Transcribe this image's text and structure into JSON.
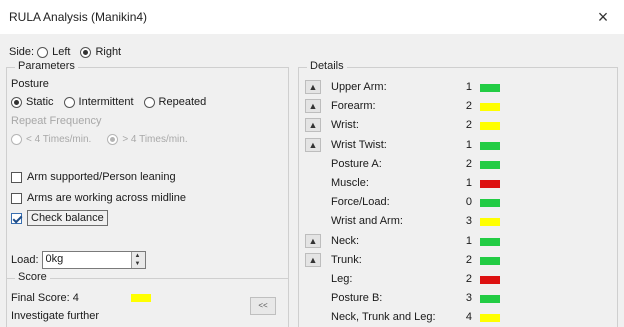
{
  "window": {
    "title": "RULA Analysis (Manikin4)",
    "close_glyph": "×"
  },
  "side": {
    "label": "Side:",
    "options": [
      {
        "label": "Left",
        "checked": false
      },
      {
        "label": "Right",
        "checked": true
      }
    ]
  },
  "parameters": {
    "group_label": "Parameters",
    "posture_label": "Posture",
    "posture_options": [
      {
        "label": "Static",
        "checked": true
      },
      {
        "label": "Intermittent",
        "checked": false
      },
      {
        "label": "Repeated",
        "checked": false
      }
    ],
    "repeat_label": "Repeat Frequency",
    "repeat_options": [
      {
        "label": "< 4 Times/min.",
        "checked": false
      },
      {
        "label": "> 4 Times/min.",
        "checked": true
      }
    ],
    "checkboxes": [
      {
        "label": "Arm supported/Person leaning",
        "checked": false
      },
      {
        "label": "Arms are working across midline",
        "checked": false
      },
      {
        "label": "Check balance",
        "checked": true
      }
    ],
    "load_label": "Load:",
    "load_value": "0kg"
  },
  "score": {
    "group_label": "Score",
    "final_label": "Final Score: 4",
    "final_color": "#ffff00",
    "status": "Investigate further",
    "collapse_label": "<<"
  },
  "details": {
    "group_label": "Details",
    "colors": {
      "green": "#22cc44",
      "yellow": "#ffff00",
      "red": "#dd1111"
    },
    "rows": [
      {
        "label": "Upper Arm:",
        "value": "1",
        "color": "green",
        "expander": true
      },
      {
        "label": "Forearm:",
        "value": "2",
        "color": "yellow",
        "expander": true
      },
      {
        "label": "Wrist:",
        "value": "2",
        "color": "yellow",
        "expander": true
      },
      {
        "label": "Wrist Twist:",
        "value": "1",
        "color": "green",
        "expander": true
      },
      {
        "label": "Posture A:",
        "value": "2",
        "color": "green",
        "expander": false
      },
      {
        "label": "Muscle:",
        "value": "1",
        "color": "red",
        "expander": false
      },
      {
        "label": "Force/Load:",
        "value": "0",
        "color": "green",
        "expander": false
      },
      {
        "label": "Wrist and Arm:",
        "value": "3",
        "color": "yellow",
        "expander": false
      },
      {
        "label": "Neck:",
        "value": "1",
        "color": "green",
        "expander": true
      },
      {
        "label": "Trunk:",
        "value": "2",
        "color": "green",
        "expander": true
      },
      {
        "label": "Leg:",
        "value": "2",
        "color": "red",
        "expander": false
      },
      {
        "label": "Posture B:",
        "value": "3",
        "color": "green",
        "expander": false
      },
      {
        "label": "Neck, Trunk and Leg:",
        "value": "4",
        "color": "yellow",
        "expander": false
      }
    ]
  },
  "icons": {
    "expander": "up-arrow-icon",
    "spin_up": "spin-up-icon",
    "spin_down": "spin-down-icon"
  }
}
